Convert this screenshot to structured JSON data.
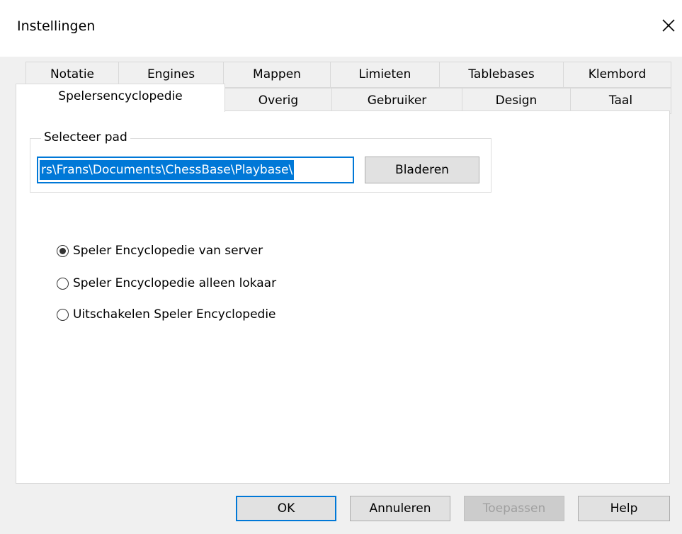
{
  "window": {
    "title": "Instellingen"
  },
  "tabs_row1": [
    "Notatie",
    "Engines",
    "Mappen",
    "Limieten",
    "Tablebases",
    "Klembord"
  ],
  "tabs_row2": [
    "Spelersencyclopedie",
    "Overig",
    "Gebruiker",
    "Design",
    "Taal"
  ],
  "active_tab": "Spelersencyclopedie",
  "path_group": {
    "label": "Selecteer pad",
    "path_value": "rs\\Frans\\Documents\\ChessBase\\Playbase\\",
    "browse_label": "Bladeren"
  },
  "options": [
    {
      "label": "Speler Encyclopedie van server",
      "checked": true
    },
    {
      "label": "Speler Encyclopedie alleen lokaar",
      "checked": false
    },
    {
      "label": "Uitschakelen Speler Encyclopedie",
      "checked": false
    }
  ],
  "footer": {
    "ok": "OK",
    "cancel": "Annuleren",
    "apply": "Toepassen",
    "help": "Help"
  },
  "colors": {
    "accent": "#0078d7",
    "face": "#f0f0f0"
  }
}
